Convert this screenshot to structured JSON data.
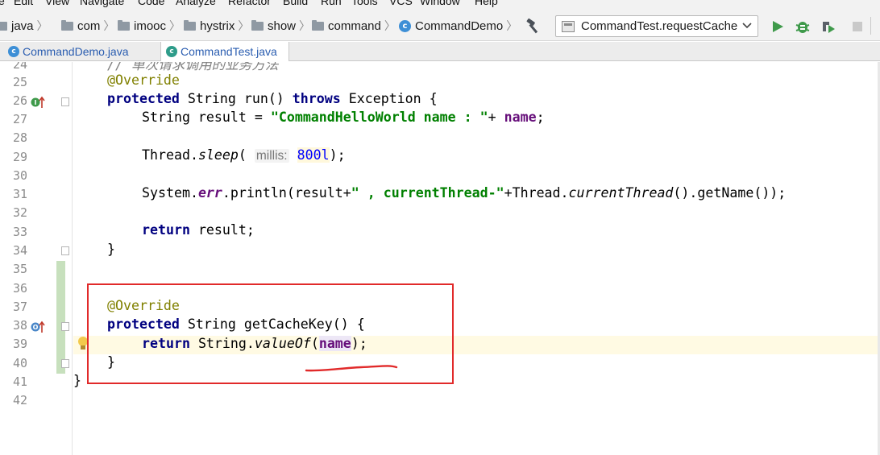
{
  "menu": [
    "e",
    "Edit",
    "View",
    "Navigate",
    "Code",
    "Analyze",
    "Refactor",
    "Build",
    "Run",
    "Tools",
    "VCS",
    "Window",
    "Help"
  ],
  "breadcrumbs": [
    "java",
    "com",
    "imooc",
    "hystrix",
    "show",
    "command",
    "CommandDemo"
  ],
  "run_config": "CommandTest.requestCache",
  "tabs": [
    {
      "label": "CommandDemo.java",
      "active": false
    },
    {
      "label": "CommandTest.java",
      "active": true
    }
  ],
  "editor": {
    "line_numbers": [
      "24",
      "25",
      "26",
      "27",
      "28",
      "29",
      "30",
      "31",
      "32",
      "33",
      "34",
      "35",
      "36",
      "37",
      "38",
      "39",
      "40",
      "41",
      "42"
    ],
    "code": {
      "l24_comment": "// 单次请求调用的业务方法",
      "annotation": "@Override",
      "kw_protected": "protected",
      "kw_throws": "throws",
      "kw_return": "return",
      "run_sig_a": " String run() ",
      "run_sig_b": " Exception {",
      "l27_a": "String result = ",
      "l27_str": "\"CommandHelloWorld name : \"",
      "l27_b": "+ ",
      "field_name": "name",
      "semi": ";",
      "l29_a": "Thread.",
      "l29_sleep": "sleep",
      "l29_b": "( ",
      "l29_hint": "millis:",
      "l29_num": "800l",
      "l29_c": ");",
      "l31_a": "System.",
      "l31_err": "err",
      "l31_b": ".println(result+",
      "l31_str": "\" , currentThread-\"",
      "l31_c": "+Thread.",
      "l31_ct": "currentThread",
      "l31_d": "().getName());",
      "l33_b": " result;",
      "close_brace": "}",
      "l38_b": " String getCacheKey() {",
      "l39_b": " String.",
      "l39_valueOf": "valueOf",
      "l39_c": "(",
      "l39_d": ");"
    }
  },
  "colors": {
    "keyword": "#000080",
    "annotation": "#808000",
    "string": "#008000",
    "field": "#660e7a",
    "highlight_box": "#e12a2a"
  }
}
